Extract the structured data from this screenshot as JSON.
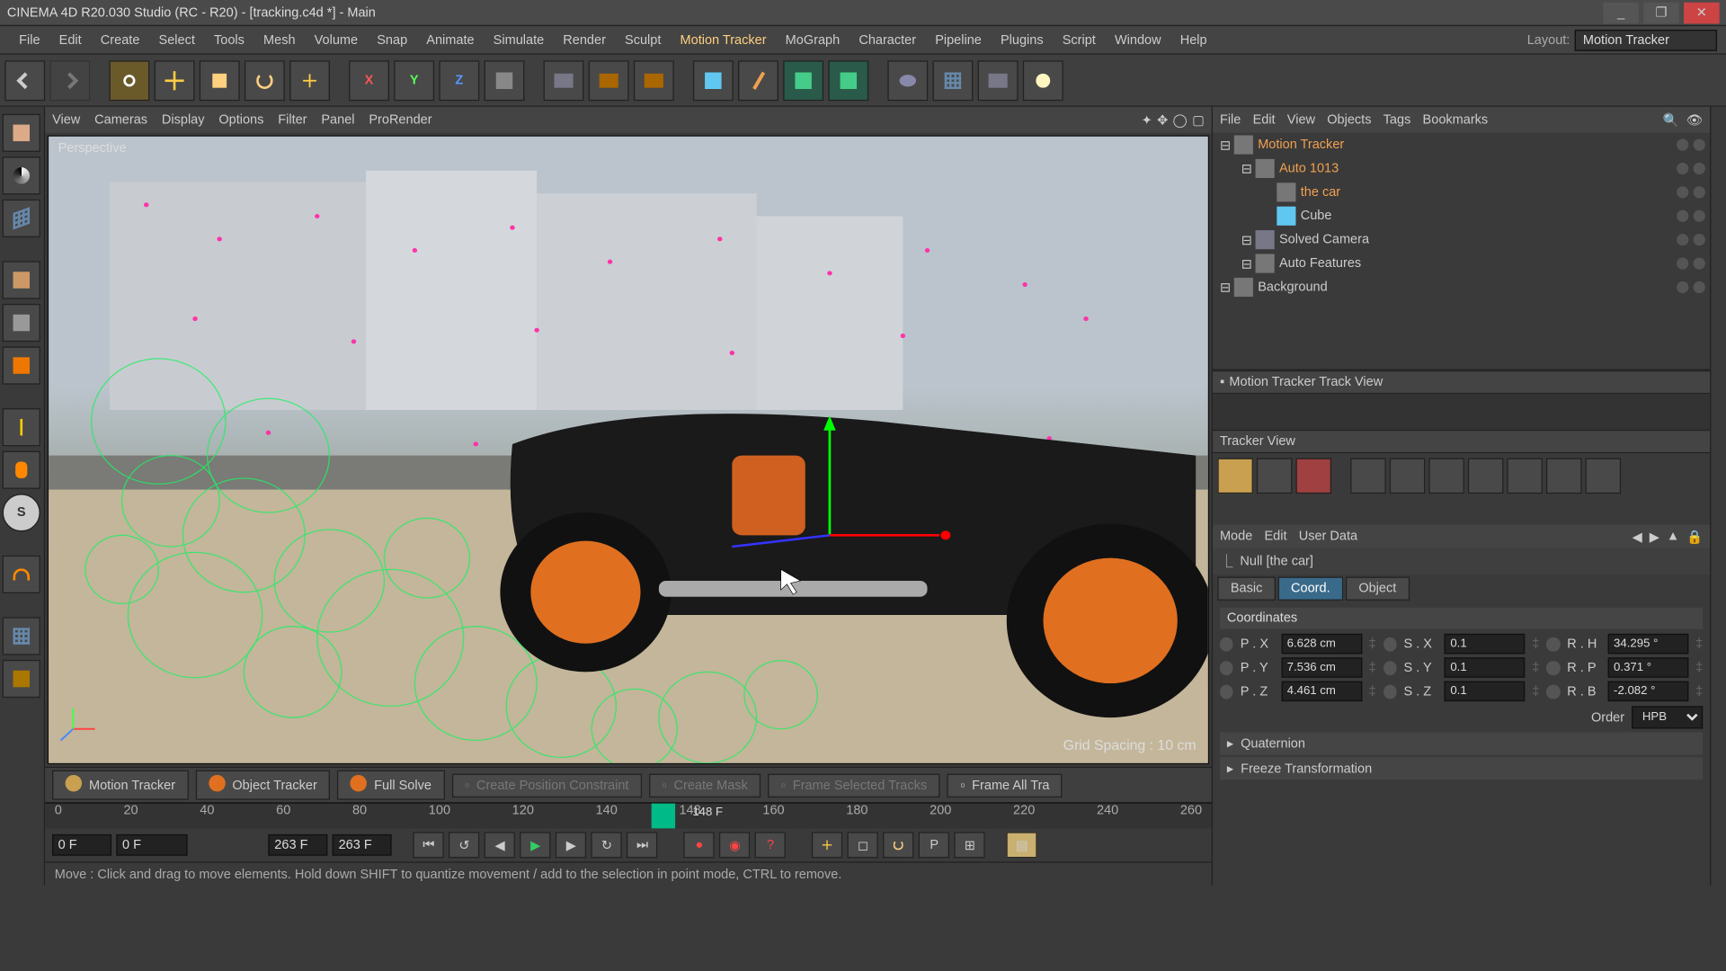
{
  "window": {
    "title": "CINEMA 4D R20.030 Studio (RC - R20) - [tracking.c4d *] - Main",
    "min": "_",
    "max": "❐",
    "close": "✕"
  },
  "menu": {
    "items": [
      "File",
      "Edit",
      "Create",
      "Select",
      "Tools",
      "Mesh",
      "Volume",
      "Snap",
      "Animate",
      "Simulate",
      "Render",
      "Sculpt",
      "Motion Tracker",
      "MoGraph",
      "Character",
      "Pipeline",
      "Plugins",
      "Script",
      "Window",
      "Help"
    ],
    "active": "Motion Tracker",
    "layout_label": "Layout:",
    "layout_value": "Motion Tracker"
  },
  "toolbar_icons": [
    "undo",
    "redo",
    "select",
    "move",
    "scale",
    "rotate",
    "axis",
    "x",
    "y",
    "z",
    "cube-mode",
    "clap1",
    "clap2",
    "clap3",
    "primitive",
    "pen",
    "def1",
    "def2",
    "tag",
    "grid",
    "cam",
    "light"
  ],
  "left_palette": [
    "model",
    "poly",
    "point",
    "edge",
    "uv",
    "axis",
    "obj",
    "line",
    "snap",
    "xform",
    "magnet",
    "floor",
    "world"
  ],
  "viewport": {
    "menu": [
      "View",
      "Cameras",
      "Display",
      "Options",
      "Filter",
      "Panel",
      "ProRender"
    ],
    "label": "Perspective",
    "grid": "Grid Spacing : 10 cm"
  },
  "tracking": {
    "tabs": [
      "Motion Tracker",
      "Object Tracker",
      "Full Solve",
      "Create Position Constraint",
      "Create Mask",
      "Frame Selected Tracks",
      "Frame All Tra"
    ]
  },
  "timeline": {
    "ticks": [
      "0",
      "20",
      "40",
      "60",
      "80",
      "100",
      "120",
      "140",
      "148",
      "160",
      "180",
      "200",
      "220",
      "240",
      "260"
    ],
    "current": "148 F"
  },
  "transport": {
    "frame_start": "0 F",
    "frame_mid": "0 F",
    "frame_end": "263 F",
    "frame_total": "263 F"
  },
  "status": {
    "text": "Move : Click and drag to move elements. Hold down SHIFT to quantize movement / add to the selection in point mode, CTRL to remove."
  },
  "objects_panel": {
    "menu": [
      "File",
      "Edit",
      "View",
      "Objects",
      "Tags",
      "Bookmarks"
    ],
    "tree": [
      {
        "name": "Motion Tracker",
        "indent": 0,
        "cls": "orange",
        "icon": "motion-tracker-icon"
      },
      {
        "name": "Auto 1013",
        "indent": 1,
        "cls": "orange",
        "icon": "null-icon"
      },
      {
        "name": "the car",
        "indent": 2,
        "cls": "orange",
        "icon": "null-icon"
      },
      {
        "name": "Cube",
        "indent": 2,
        "cls": "",
        "icon": "cube-icon"
      },
      {
        "name": "Solved Camera",
        "indent": 1,
        "cls": "",
        "icon": "camera-icon"
      },
      {
        "name": "Auto Features",
        "indent": 1,
        "cls": "",
        "icon": "null-icon"
      },
      {
        "name": "Background",
        "indent": 0,
        "cls": "",
        "icon": "background-icon"
      }
    ]
  },
  "track_view": {
    "header": "Motion Tracker Track View",
    "subheader": "Tracker View"
  },
  "attribute_manager": {
    "menu": [
      "Mode",
      "Edit",
      "User Data"
    ],
    "object_name": "Null [the car]",
    "tabs": [
      "Basic",
      "Coord.",
      "Object"
    ],
    "active_tab": "Coord.",
    "section": "Coordinates",
    "rows": [
      {
        "p": "P . X",
        "pv": "6.628 cm",
        "s": "S . X",
        "sv": "0.1",
        "r": "R . H",
        "rv": "34.295 °"
      },
      {
        "p": "P . Y",
        "pv": "7.536 cm",
        "s": "S . Y",
        "sv": "0.1",
        "r": "R . P",
        "rv": "0.371 °"
      },
      {
        "p": "P . Z",
        "pv": "4.461 cm",
        "s": "S . Z",
        "sv": "0.1",
        "r": "R . B",
        "rv": "-2.082 °"
      }
    ],
    "order_label": "Order",
    "order_value": "HPB",
    "fold1": "Quaternion",
    "fold2": "Freeze Transformation"
  }
}
